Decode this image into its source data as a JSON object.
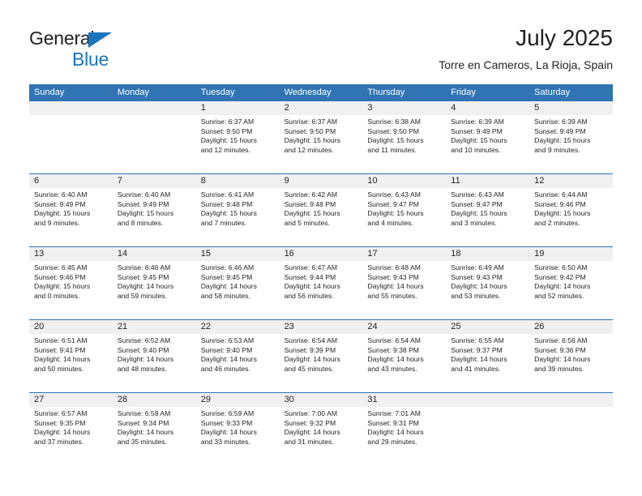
{
  "brand": {
    "line1": "General",
    "line2": "Blue",
    "triangle_color": "#1b75bc",
    "text_color": "#231f20"
  },
  "header": {
    "title": "July 2025",
    "subtitle": "Torre en Cameros, La Rioja, Spain"
  },
  "colors": {
    "header_blue": "#3074b4",
    "row_divider_blue": "#3074b4",
    "day_band_gray": "#f0f0f0",
    "text": "#231f20",
    "header_text": "#ffffff"
  },
  "calendar": {
    "weekdays": [
      "Sunday",
      "Monday",
      "Tuesday",
      "Wednesday",
      "Thursday",
      "Friday",
      "Saturday"
    ],
    "weeks": [
      [
        {
          "empty": true
        },
        {
          "empty": true
        },
        {
          "day": "1",
          "sunrise": "Sunrise: 6:37 AM",
          "sunset": "Sunset: 9:50 PM",
          "daylight1": "Daylight: 15 hours",
          "daylight2": "and 12 minutes."
        },
        {
          "day": "2",
          "sunrise": "Sunrise: 6:37 AM",
          "sunset": "Sunset: 9:50 PM",
          "daylight1": "Daylight: 15 hours",
          "daylight2": "and 12 minutes."
        },
        {
          "day": "3",
          "sunrise": "Sunrise: 6:38 AM",
          "sunset": "Sunset: 9:50 PM",
          "daylight1": "Daylight: 15 hours",
          "daylight2": "and 11 minutes."
        },
        {
          "day": "4",
          "sunrise": "Sunrise: 6:39 AM",
          "sunset": "Sunset: 9:49 PM",
          "daylight1": "Daylight: 15 hours",
          "daylight2": "and 10 minutes."
        },
        {
          "day": "5",
          "sunrise": "Sunrise: 6:39 AM",
          "sunset": "Sunset: 9:49 PM",
          "daylight1": "Daylight: 15 hours",
          "daylight2": "and 9 minutes."
        }
      ],
      [
        {
          "day": "6",
          "sunrise": "Sunrise: 6:40 AM",
          "sunset": "Sunset: 9:49 PM",
          "daylight1": "Daylight: 15 hours",
          "daylight2": "and 9 minutes."
        },
        {
          "day": "7",
          "sunrise": "Sunrise: 6:40 AM",
          "sunset": "Sunset: 9:49 PM",
          "daylight1": "Daylight: 15 hours",
          "daylight2": "and 8 minutes."
        },
        {
          "day": "8",
          "sunrise": "Sunrise: 6:41 AM",
          "sunset": "Sunset: 9:48 PM",
          "daylight1": "Daylight: 15 hours",
          "daylight2": "and 7 minutes."
        },
        {
          "day": "9",
          "sunrise": "Sunrise: 6:42 AM",
          "sunset": "Sunset: 9:48 PM",
          "daylight1": "Daylight: 15 hours",
          "daylight2": "and 5 minutes."
        },
        {
          "day": "10",
          "sunrise": "Sunrise: 6:43 AM",
          "sunset": "Sunset: 9:47 PM",
          "daylight1": "Daylight: 15 hours",
          "daylight2": "and 4 minutes."
        },
        {
          "day": "11",
          "sunrise": "Sunrise: 6:43 AM",
          "sunset": "Sunset: 9:47 PM",
          "daylight1": "Daylight: 15 hours",
          "daylight2": "and 3 minutes."
        },
        {
          "day": "12",
          "sunrise": "Sunrise: 6:44 AM",
          "sunset": "Sunset: 9:46 PM",
          "daylight1": "Daylight: 15 hours",
          "daylight2": "and 2 minutes."
        }
      ],
      [
        {
          "day": "13",
          "sunrise": "Sunrise: 6:45 AM",
          "sunset": "Sunset: 9:46 PM",
          "daylight1": "Daylight: 15 hours",
          "daylight2": "and 0 minutes."
        },
        {
          "day": "14",
          "sunrise": "Sunrise: 6:46 AM",
          "sunset": "Sunset: 9:45 PM",
          "daylight1": "Daylight: 14 hours",
          "daylight2": "and 59 minutes."
        },
        {
          "day": "15",
          "sunrise": "Sunrise: 6:46 AM",
          "sunset": "Sunset: 9:45 PM",
          "daylight1": "Daylight: 14 hours",
          "daylight2": "and 58 minutes."
        },
        {
          "day": "16",
          "sunrise": "Sunrise: 6:47 AM",
          "sunset": "Sunset: 9:44 PM",
          "daylight1": "Daylight: 14 hours",
          "daylight2": "and 56 minutes."
        },
        {
          "day": "17",
          "sunrise": "Sunrise: 6:48 AM",
          "sunset": "Sunset: 9:43 PM",
          "daylight1": "Daylight: 14 hours",
          "daylight2": "and 55 minutes."
        },
        {
          "day": "18",
          "sunrise": "Sunrise: 6:49 AM",
          "sunset": "Sunset: 9:43 PM",
          "daylight1": "Daylight: 14 hours",
          "daylight2": "and 53 minutes."
        },
        {
          "day": "19",
          "sunrise": "Sunrise: 6:50 AM",
          "sunset": "Sunset: 9:42 PM",
          "daylight1": "Daylight: 14 hours",
          "daylight2": "and 52 minutes."
        }
      ],
      [
        {
          "day": "20",
          "sunrise": "Sunrise: 6:51 AM",
          "sunset": "Sunset: 9:41 PM",
          "daylight1": "Daylight: 14 hours",
          "daylight2": "and 50 minutes."
        },
        {
          "day": "21",
          "sunrise": "Sunrise: 6:52 AM",
          "sunset": "Sunset: 9:40 PM",
          "daylight1": "Daylight: 14 hours",
          "daylight2": "and 48 minutes."
        },
        {
          "day": "22",
          "sunrise": "Sunrise: 6:53 AM",
          "sunset": "Sunset: 9:40 PM",
          "daylight1": "Daylight: 14 hours",
          "daylight2": "and 46 minutes."
        },
        {
          "day": "23",
          "sunrise": "Sunrise: 6:54 AM",
          "sunset": "Sunset: 9:39 PM",
          "daylight1": "Daylight: 14 hours",
          "daylight2": "and 45 minutes."
        },
        {
          "day": "24",
          "sunrise": "Sunrise: 6:54 AM",
          "sunset": "Sunset: 9:38 PM",
          "daylight1": "Daylight: 14 hours",
          "daylight2": "and 43 minutes."
        },
        {
          "day": "25",
          "sunrise": "Sunrise: 6:55 AM",
          "sunset": "Sunset: 9:37 PM",
          "daylight1": "Daylight: 14 hours",
          "daylight2": "and 41 minutes."
        },
        {
          "day": "26",
          "sunrise": "Sunrise: 6:56 AM",
          "sunset": "Sunset: 9:36 PM",
          "daylight1": "Daylight: 14 hours",
          "daylight2": "and 39 minutes."
        }
      ],
      [
        {
          "day": "27",
          "sunrise": "Sunrise: 6:57 AM",
          "sunset": "Sunset: 9:35 PM",
          "daylight1": "Daylight: 14 hours",
          "daylight2": "and 37 minutes."
        },
        {
          "day": "28",
          "sunrise": "Sunrise: 6:58 AM",
          "sunset": "Sunset: 9:34 PM",
          "daylight1": "Daylight: 14 hours",
          "daylight2": "and 35 minutes."
        },
        {
          "day": "29",
          "sunrise": "Sunrise: 6:59 AM",
          "sunset": "Sunset: 9:33 PM",
          "daylight1": "Daylight: 14 hours",
          "daylight2": "and 33 minutes."
        },
        {
          "day": "30",
          "sunrise": "Sunrise: 7:00 AM",
          "sunset": "Sunset: 9:32 PM",
          "daylight1": "Daylight: 14 hours",
          "daylight2": "and 31 minutes."
        },
        {
          "day": "31",
          "sunrise": "Sunrise: 7:01 AM",
          "sunset": "Sunset: 9:31 PM",
          "daylight1": "Daylight: 14 hours",
          "daylight2": "and 29 minutes."
        },
        {
          "empty": true
        },
        {
          "empty": true
        }
      ]
    ]
  }
}
